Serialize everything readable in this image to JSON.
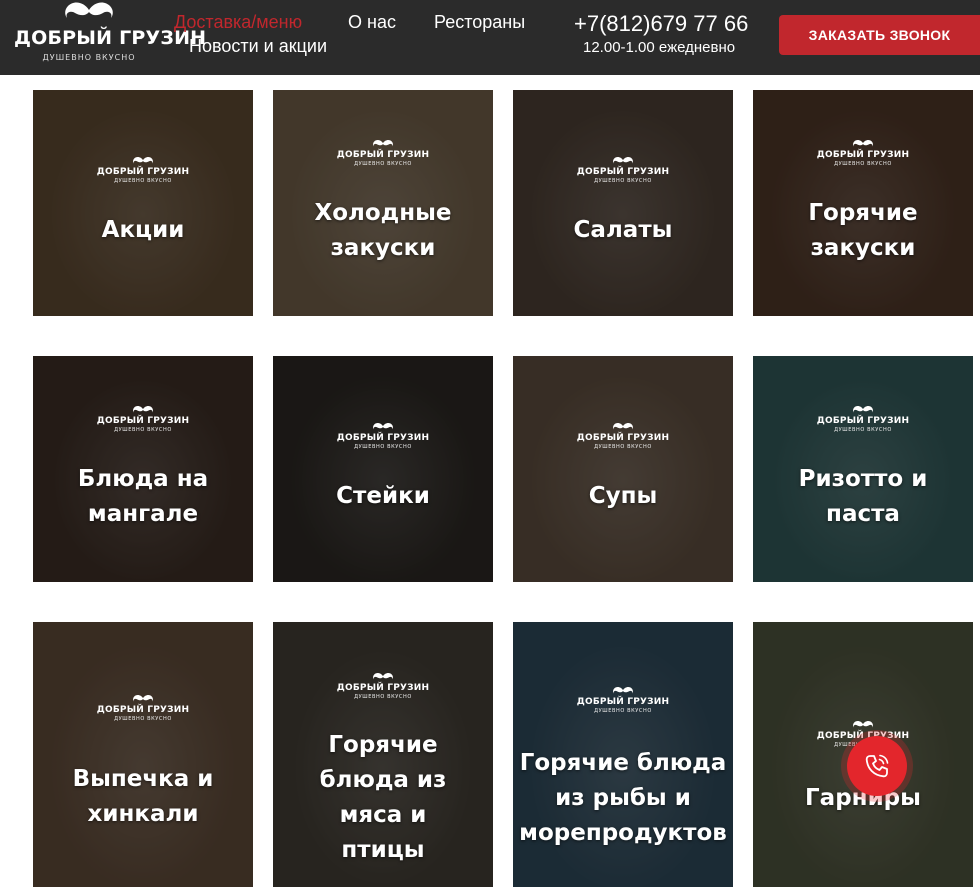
{
  "header": {
    "logo_title": "ДОБРЫЙ ГРУЗИН",
    "logo_tagline": "ДУШЕВНО ВКУСНО",
    "nav": [
      {
        "label": "Доставка/меню",
        "active": true
      },
      {
        "label": "О нас",
        "active": false
      },
      {
        "label": "Рестораны",
        "active": false
      },
      {
        "label": "Новости и акции",
        "active": false
      }
    ],
    "phone": "+7(812)679 77 66",
    "hours": "12.00-1.00 ежедневно",
    "call_button": "ЗАКАЗАТЬ ЗВОНОК"
  },
  "tile_logo": {
    "title": "ДОБРЫЙ ГРУЗИН",
    "tagline": "ДУШЕВНО ВКУСНО"
  },
  "categories": [
    {
      "lines": [
        "Акции"
      ],
      "bg": "#5a4630"
    },
    {
      "lines": [
        "Холодные",
        "закуски"
      ],
      "bg": "#6b5a45"
    },
    {
      "lines": [
        "Салаты"
      ],
      "bg": "#4a3d33"
    },
    {
      "lines": [
        "Горячие",
        "закуски"
      ],
      "bg": "#4b3426"
    },
    {
      "lines": [
        "Блюда на",
        "мангале"
      ],
      "bg": "#3a2c24"
    },
    {
      "lines": [
        "Стейки"
      ],
      "bg": "#2a2622"
    },
    {
      "lines": [
        "Супы"
      ],
      "bg": "#5a4a3c"
    },
    {
      "lines": [
        "Ризотто и",
        "паста"
      ],
      "bg": "#2f5454"
    },
    {
      "lines": [
        "Выпечка и",
        "хинкали"
      ],
      "bg": "#5b4736"
    },
    {
      "lines": [
        "Горячие",
        "блюда из",
        "мяса и",
        "птицы"
      ],
      "bg": "#3f3a32"
    },
    {
      "lines": [
        "Горячие блюда",
        "из рыбы и",
        "морепродуктов"
      ],
      "bg": "#2d4656"
    },
    {
      "lines": [
        "Гарниры"
      ],
      "bg": "#4a4f3a"
    }
  ],
  "colors": {
    "header_bg": "#2b2b2b",
    "accent": "#c1272d",
    "float_button": "#e3262c"
  },
  "icons": {
    "float_button": "phone-icon",
    "logo": "mustache-icon"
  }
}
